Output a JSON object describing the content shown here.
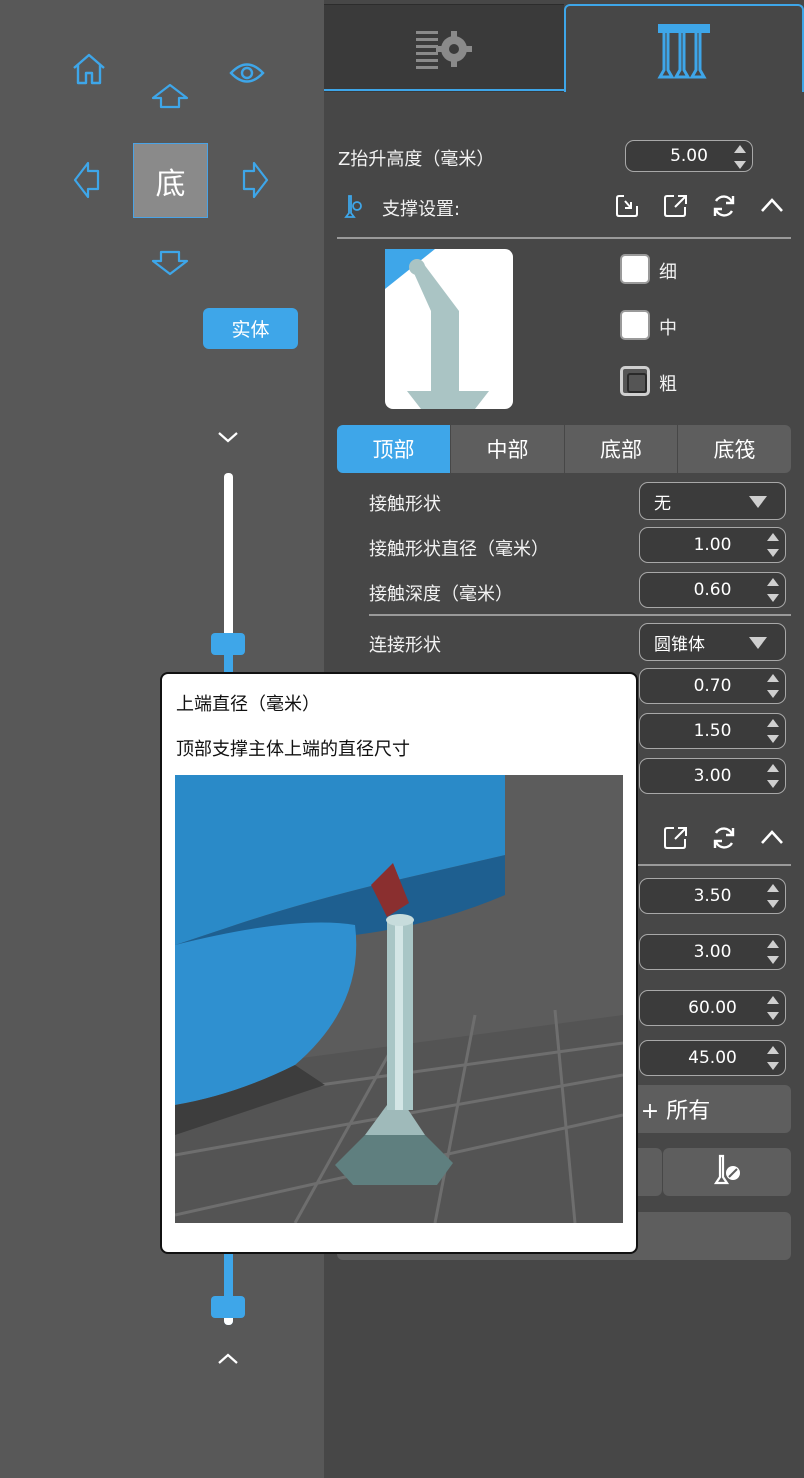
{
  "view_panel": {
    "cube_face_label": "底",
    "solid_button": "实体",
    "icons": [
      "home-icon",
      "eye-icon",
      "arrow-up-icon",
      "arrow-left-icon",
      "arrow-right-icon",
      "arrow-down-icon",
      "chevron-down-icon",
      "chevron-up-icon"
    ]
  },
  "tabs": [
    {
      "name": "settings",
      "icon": "list-gear-icon"
    },
    {
      "name": "support",
      "icon": "support-table-icon"
    }
  ],
  "z_lift": {
    "label": "Z抬升高度（毫米）",
    "value": "5.00"
  },
  "support_settings": {
    "label": "支撑设置:",
    "icons": [
      "support-icon",
      "import-icon",
      "export-icon",
      "reset-icon",
      "collapse-icon"
    ]
  },
  "density": [
    {
      "label": "细",
      "checked": false
    },
    {
      "label": "中",
      "checked": false
    },
    {
      "label": "粗",
      "checked": true
    }
  ],
  "part_tabs": [
    {
      "label": "顶部",
      "active": true
    },
    {
      "label": "中部",
      "active": false
    },
    {
      "label": "底部",
      "active": false
    },
    {
      "label": "底筏",
      "active": false
    }
  ],
  "params": {
    "contact_shape": {
      "label": "接触形状",
      "value": "无"
    },
    "contact_diameter": {
      "label": "接触形状直径（毫米）",
      "value": "1.00"
    },
    "contact_depth": {
      "label": "接触深度（毫米）",
      "value": "0.60"
    },
    "connection_shape": {
      "label": "连接形状",
      "value": "圆锥体"
    },
    "upper_diameter": {
      "value": "0.70"
    },
    "lower_diameter": {
      "value": "1.50"
    },
    "length": {
      "value": "3.00"
    }
  },
  "section2_values": [
    "3.50",
    "3.00",
    "60.00",
    "45.00"
  ],
  "add_all_button": "+ 所有",
  "tooltip": {
    "title": "上端直径（毫米）",
    "description": "顶部支撑主体上端的直径尺寸"
  },
  "colors": {
    "accent": "#3ea6e9",
    "panel": "#474747",
    "left_panel": "#585858"
  }
}
